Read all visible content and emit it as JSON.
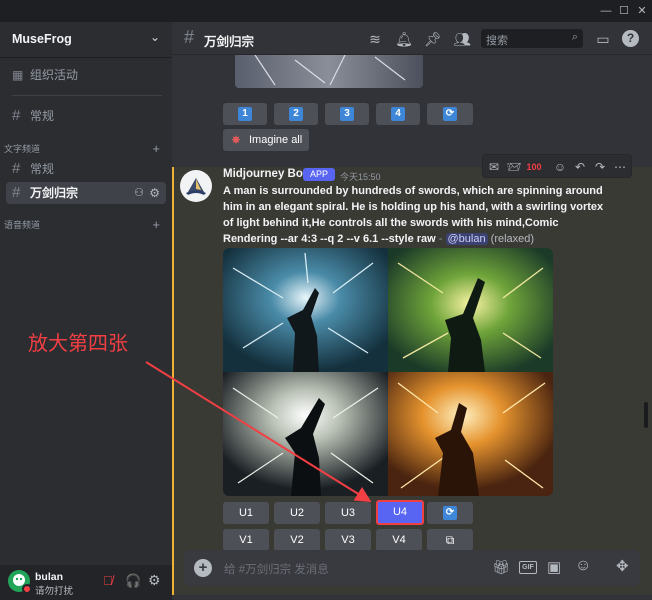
{
  "window": {
    "minimize": "—",
    "maximize": "☐",
    "close": "✕"
  },
  "server": {
    "name": "MuseFrog"
  },
  "sidebar": {
    "event_label": "组织活动",
    "general": "常规",
    "category_text": "文字频道",
    "text_channels": [
      "常规",
      "万剑归宗"
    ],
    "category_voice": "语音频道"
  },
  "user": {
    "name": "bulan",
    "status": "请勿打扰"
  },
  "channel": {
    "title": "万剑归宗"
  },
  "search": {
    "placeholder": "搜索"
  },
  "prev_buttons": {
    "numbers": [
      "1",
      "2",
      "3",
      "4"
    ],
    "imagine_all": "Imagine all"
  },
  "message": {
    "author": "Midjourney Bot",
    "badge": "APP",
    "time": "今天15:50",
    "prompt": "A man is surrounded by hundreds of swords, which are spinning around him in an elegant spiral. He is holding up his hand, with a swirling vortex of light behind it,He controls all the swords with his mind,Comic Rendering --ar 4:3 --q 2 --v 6.1 --style raw",
    "dash": " - ",
    "mention": "@bulan",
    "mode": " (relaxed)"
  },
  "upscale_buttons": [
    "U1",
    "U2",
    "U3",
    "U4"
  ],
  "variation_buttons": [
    "V1",
    "V2",
    "V3",
    "V4"
  ],
  "composer": {
    "placeholder": "给 #万剑归宗 发消息"
  },
  "annotation": "放大第四张",
  "colors": {
    "accent": "#5865f2",
    "highlight": "#f23f43",
    "mention_border": "#f0b232"
  }
}
